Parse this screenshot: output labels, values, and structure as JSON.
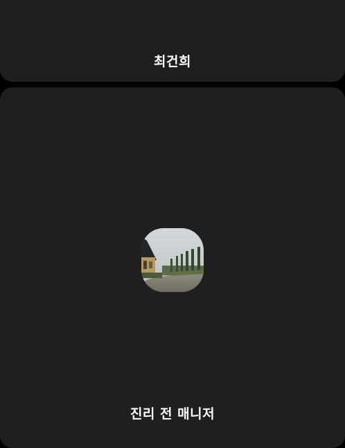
{
  "participants": [
    {
      "name": "최건희",
      "camera_off": true,
      "has_avatar": false
    },
    {
      "name": "진리 전 매니저",
      "camera_off": true,
      "has_avatar": true,
      "avatar": "outdoor-path-photo"
    }
  ],
  "colors": {
    "page_background": "#000000",
    "tile_background": "#1f1f20",
    "name_text": "#ffffff"
  }
}
